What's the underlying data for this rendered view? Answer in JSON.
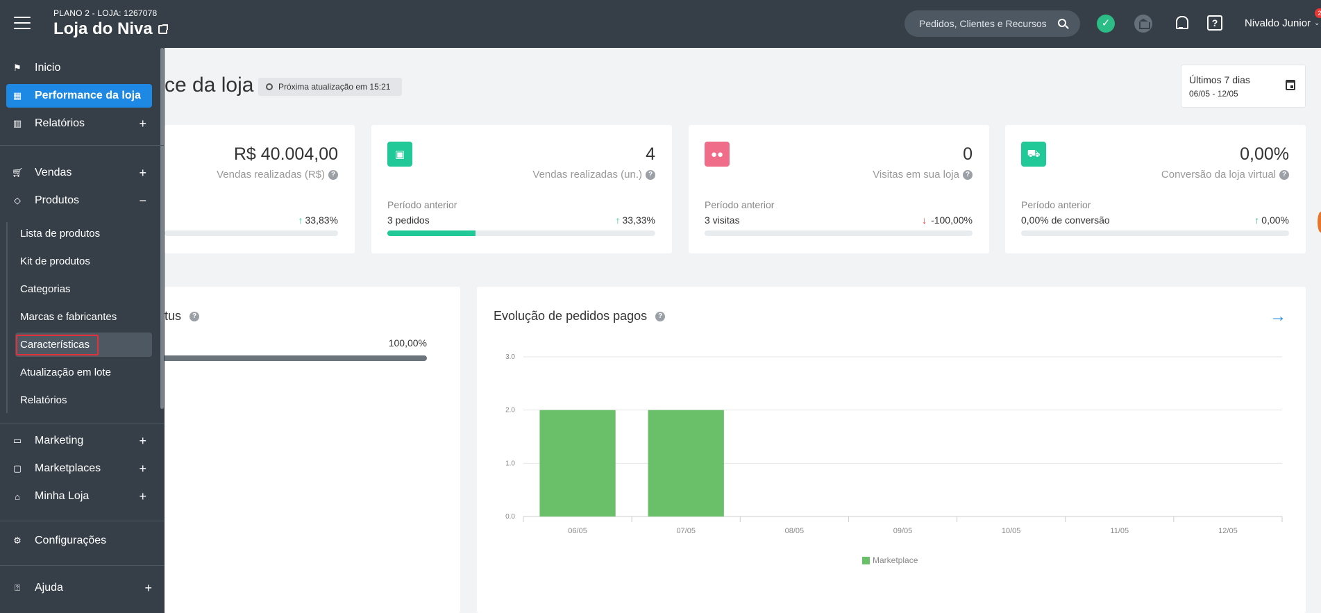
{
  "header": {
    "plan": "PLANO 2 - LOJA: 1267078",
    "store_name": "Loja do Niva",
    "search_placeholder": "Pedidos, Clientes e Recursos",
    "user_name": "Nivaldo Junior",
    "notification_count": "2"
  },
  "sidebar": {
    "items": [
      {
        "label": "Inicio",
        "icon": "flag-icon"
      },
      {
        "label": "Performance da loja",
        "icon": "dashboard-icon"
      },
      {
        "label": "Relatórios",
        "icon": "bar-chart-icon"
      },
      {
        "label": "Vendas",
        "icon": "cart-icon"
      },
      {
        "label": "Produtos",
        "icon": "tag-icon"
      },
      {
        "label": "Marketing",
        "icon": "tv-icon"
      },
      {
        "label": "Marketplaces",
        "icon": "monitor-icon"
      },
      {
        "label": "Minha Loja",
        "icon": "home-icon"
      },
      {
        "label": "Configurações",
        "icon": "gear-icon"
      },
      {
        "label": "Ajuda",
        "icon": "help-icon"
      }
    ],
    "produtos_sub": [
      "Lista de produtos",
      "Kit de produtos",
      "Categorias",
      "Marcas e fabricantes",
      "Características",
      "Atualização em lote",
      "Relatórios"
    ],
    "plus": "+",
    "minus": "−"
  },
  "main": {
    "title_visible": "ce da loja",
    "update_chip": "Próxima atualização em 15:21",
    "date_range_label": "Últimos 7 dias",
    "date_range": "06/05 - 12/05",
    "cards": [
      {
        "value": "R$ 40.004,00",
        "label": "Vendas realizadas (R$)",
        "prev_label": "",
        "prev_value": "",
        "delta": "33,83%",
        "direction": "up",
        "fill": 0
      },
      {
        "value": "4",
        "label": "Vendas realizadas (un.)",
        "prev_label": "Período anterior",
        "prev_value": "3 pedidos",
        "delta": "33,33%",
        "direction": "up",
        "fill": 0.33
      },
      {
        "value": "0",
        "label": "Visitas em sua loja",
        "prev_label": "Período anterior",
        "prev_value": "3 visitas",
        "delta": "-100,00%",
        "direction": "down",
        "fill": 0
      },
      {
        "value": "0,00%",
        "label": "Conversão da loja virtual",
        "prev_label": "Período anterior",
        "prev_value": "0,00% de conversão",
        "delta": "0,00%",
        "direction": "up",
        "fill": 0
      }
    ],
    "status_panel": {
      "title_visible": "tus",
      "percent": "100,00%"
    },
    "orders_panel": {
      "title": "Evolução de pedidos pagos"
    },
    "question_mark": "?"
  },
  "chart_data": {
    "type": "bar",
    "title": "Evolução de pedidos pagos",
    "categories": [
      "06/05",
      "07/05",
      "08/05",
      "09/05",
      "10/05",
      "11/05",
      "12/05"
    ],
    "series": [
      {
        "name": "Marketplace",
        "values": [
          2,
          2,
          0,
          0,
          0,
          0,
          0
        ]
      }
    ],
    "ylim": [
      0,
      3
    ],
    "yticks": [
      "0.0",
      "1.0",
      "2.0",
      "3.0"
    ],
    "color": "#6abf69",
    "grid": true,
    "legend": "bottom"
  },
  "colors": {
    "topbar": "#363f48",
    "active": "#1e88e5",
    "teal": "#20c997",
    "pink": "#f06d8a"
  }
}
